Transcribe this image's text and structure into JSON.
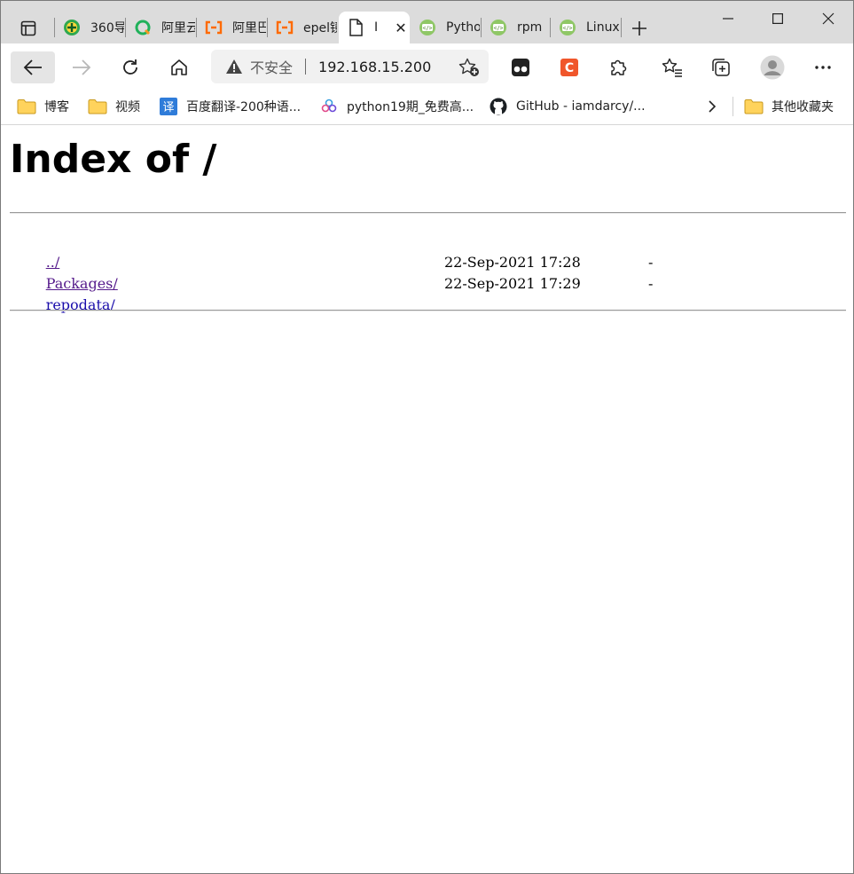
{
  "tabs": [
    {
      "title": "360导",
      "icon": "360-icon"
    },
    {
      "title": "阿里云",
      "icon": "aliyun-q-icon"
    },
    {
      "title": "阿里巴",
      "icon": "aliyun-icon"
    },
    {
      "title": "epel镜",
      "icon": "aliyun-icon"
    },
    {
      "title": "I",
      "icon": "page-icon",
      "active": true
    },
    {
      "title": "Pytho",
      "icon": "devtools-icon"
    },
    {
      "title": "rpm",
      "icon": "devtools-icon"
    },
    {
      "title": "Linux",
      "icon": "devtools-icon"
    }
  ],
  "address": {
    "security_label": "不安全",
    "url": "192.168.15.200"
  },
  "bookmarks": [
    {
      "label": "博客",
      "icon": "folder-icon"
    },
    {
      "label": "视频",
      "icon": "folder-icon"
    },
    {
      "label": "百度翻译-200种语...",
      "icon": "translate-icon"
    },
    {
      "label": "python19期_免费高...",
      "icon": "bubbles-icon"
    },
    {
      "label": "GitHub - iamdarcy/...",
      "icon": "github-icon"
    }
  ],
  "other_bookmarks": "其他收藏夹",
  "page": {
    "heading": "Index of /",
    "parent": "../",
    "entries": [
      {
        "name": "Packages/",
        "date": "22-Sep-2021 17:28",
        "size": "-"
      },
      {
        "name": "repodata/",
        "date": "22-Sep-2021 17:29",
        "size": "-"
      }
    ]
  },
  "colors": {
    "link_visited": "#551a8b",
    "tabstrip_bg": "#dcdcdc",
    "accent_orange": "#f0562b"
  }
}
